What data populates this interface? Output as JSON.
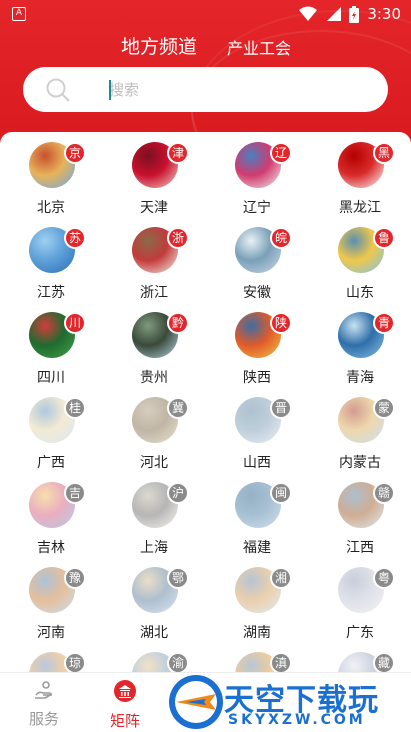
{
  "status_bar": {
    "time": "3:30",
    "app_icon_letter": "A"
  },
  "tabs": [
    {
      "label": "地方频道",
      "active": true
    },
    {
      "label": "产业工会",
      "active": false
    }
  ],
  "search": {
    "placeholder": "搜索"
  },
  "regions": [
    {
      "name": "北京",
      "badge": "京",
      "badge_color": "red"
    },
    {
      "name": "天津",
      "badge": "津",
      "badge_color": "red"
    },
    {
      "name": "辽宁",
      "badge": "辽",
      "badge_color": "red"
    },
    {
      "name": "黑龙江",
      "badge": "黑",
      "badge_color": "red"
    },
    {
      "name": "江苏",
      "badge": "苏",
      "badge_color": "red"
    },
    {
      "name": "浙江",
      "badge": "浙",
      "badge_color": "red"
    },
    {
      "name": "安徽",
      "badge": "皖",
      "badge_color": "red"
    },
    {
      "name": "山东",
      "badge": "鲁",
      "badge_color": "red"
    },
    {
      "name": "四川",
      "badge": "川",
      "badge_color": "red"
    },
    {
      "name": "贵州",
      "badge": "黔",
      "badge_color": "red"
    },
    {
      "name": "陕西",
      "badge": "陕",
      "badge_color": "red"
    },
    {
      "name": "青海",
      "badge": "青",
      "badge_color": "red"
    },
    {
      "name": "广西",
      "badge": "桂",
      "badge_color": "gray"
    },
    {
      "name": "河北",
      "badge": "冀",
      "badge_color": "gray"
    },
    {
      "name": "山西",
      "badge": "晋",
      "badge_color": "gray"
    },
    {
      "name": "内蒙古",
      "badge": "蒙",
      "badge_color": "gray"
    },
    {
      "name": "吉林",
      "badge": "吉",
      "badge_color": "gray"
    },
    {
      "name": "上海",
      "badge": "沪",
      "badge_color": "gray"
    },
    {
      "name": "福建",
      "badge": "闽",
      "badge_color": "gray"
    },
    {
      "name": "江西",
      "badge": "赣",
      "badge_color": "gray"
    },
    {
      "name": "河南",
      "badge": "豫",
      "badge_color": "gray"
    },
    {
      "name": "湖北",
      "badge": "鄂",
      "badge_color": "gray"
    },
    {
      "name": "湖南",
      "badge": "湘",
      "badge_color": "gray"
    },
    {
      "name": "广东",
      "badge": "粤",
      "badge_color": "gray"
    },
    {
      "name": "",
      "badge": "琼",
      "badge_color": "gray"
    },
    {
      "name": "",
      "badge": "渝",
      "badge_color": "gray"
    },
    {
      "name": "",
      "badge": "滇",
      "badge_color": "gray"
    },
    {
      "name": "",
      "badge": "藏",
      "badge_color": "gray"
    }
  ],
  "bottom_nav": [
    {
      "label": "服务",
      "active": false,
      "icon": "service-icon"
    },
    {
      "label": "矩阵",
      "active": true,
      "icon": "matrix-icon"
    }
  ],
  "watermark": {
    "chinese": "天空下载玩",
    "english": "SKYXZW.COM"
  },
  "colors": {
    "brand_red": "#e3262b",
    "badge_gray": "#8a8a8a",
    "watermark_blue": "#1b6fd1",
    "watermark_orange": "#f08a1c"
  }
}
